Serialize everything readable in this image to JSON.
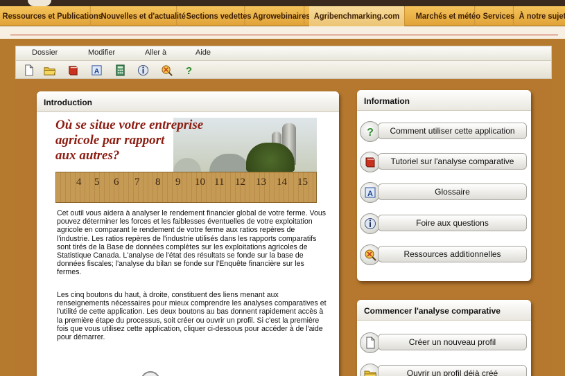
{
  "nav": {
    "items": [
      {
        "label": "Ressources et Publications"
      },
      {
        "label": "Nouvelles et d'actualité"
      },
      {
        "label": "Sections vedettes"
      },
      {
        "label": "Agrowebinaires"
      },
      {
        "label": "Agribenchmarking.com"
      },
      {
        "label": "Marchés et météo"
      },
      {
        "label": "Services"
      },
      {
        "label": "À notre sujet"
      }
    ]
  },
  "menubar": {
    "items": [
      {
        "label": "Dossier"
      },
      {
        "label": "Modifier"
      },
      {
        "label": "Aller à"
      },
      {
        "label": "Aide"
      }
    ]
  },
  "toolbar": {
    "icons": [
      "new-document-icon",
      "open-folder-icon",
      "book-icon",
      "glossary-icon",
      "calculator-icon",
      "info-icon",
      "resources-icon",
      "help-icon"
    ]
  },
  "intro": {
    "header": "Introduction",
    "banner_title": "Où se situe votre entreprise\nagricole par rapport\naux autres?",
    "ruler_numbers": [
      "4",
      "5",
      "6",
      "7",
      "8",
      "9",
      "10",
      "11",
      "12",
      "13",
      "14",
      "15"
    ],
    "paragraph1": "Cet outil vous aidera à analyser le rendement financier global de votre ferme. Vous pouvez déterminer les forces et les faiblesses éventuelles de votre exploitation agricole en comparant le rendement de votre ferme aux ratios repères de l'industrie. Les ratios repères de l'industrie utilisés dans les rapports comparatifs sont tirés de la Base de données complètes sur les exploitations agricoles de Statistique Canada. L'analyse de l'état des résultats se fonde sur la base de données fiscales; l'analyse du bilan se fonde sur l'Enquête financière sur les fermes.",
    "paragraph2": "Les cinq boutons du haut, à droite, constituent des liens menant aux renseignements nécessaires pour mieux comprendre les analyses comparatives et l'utilité de cette application. Les deux boutons au bas donnent rapidement accès à la première étape du processus, soit créer ou ouvrir un profil. Si c'est la première fois que vous utilisez cette application, cliquer ci-dessous pour accéder à de l'aide pour démarrer."
  },
  "info": {
    "header": "Information",
    "buttons": [
      {
        "label": "Comment utiliser cette application",
        "icon": "help-icon"
      },
      {
        "label": "Tutoriel sur l'analyse comparative",
        "icon": "book-icon"
      },
      {
        "label": "Glossaire",
        "icon": "glossary-icon"
      },
      {
        "label": "Foire aux questions",
        "icon": "info-icon"
      },
      {
        "label": "Ressources additionnelles",
        "icon": "resources-icon"
      }
    ]
  },
  "start": {
    "header": "Commencer l'analyse comparative",
    "buttons": [
      {
        "label": "Créer un nouveau profil",
        "icon": "new-document-icon"
      },
      {
        "label": "Ouvrir un profil déjà créé",
        "icon": "open-folder-icon"
      }
    ]
  },
  "colors": {
    "nav_gold": "#e8ad45",
    "frame_brown": "#b57a2e",
    "banner_red": "#8c1d12",
    "accent_red": "#c23a22"
  }
}
